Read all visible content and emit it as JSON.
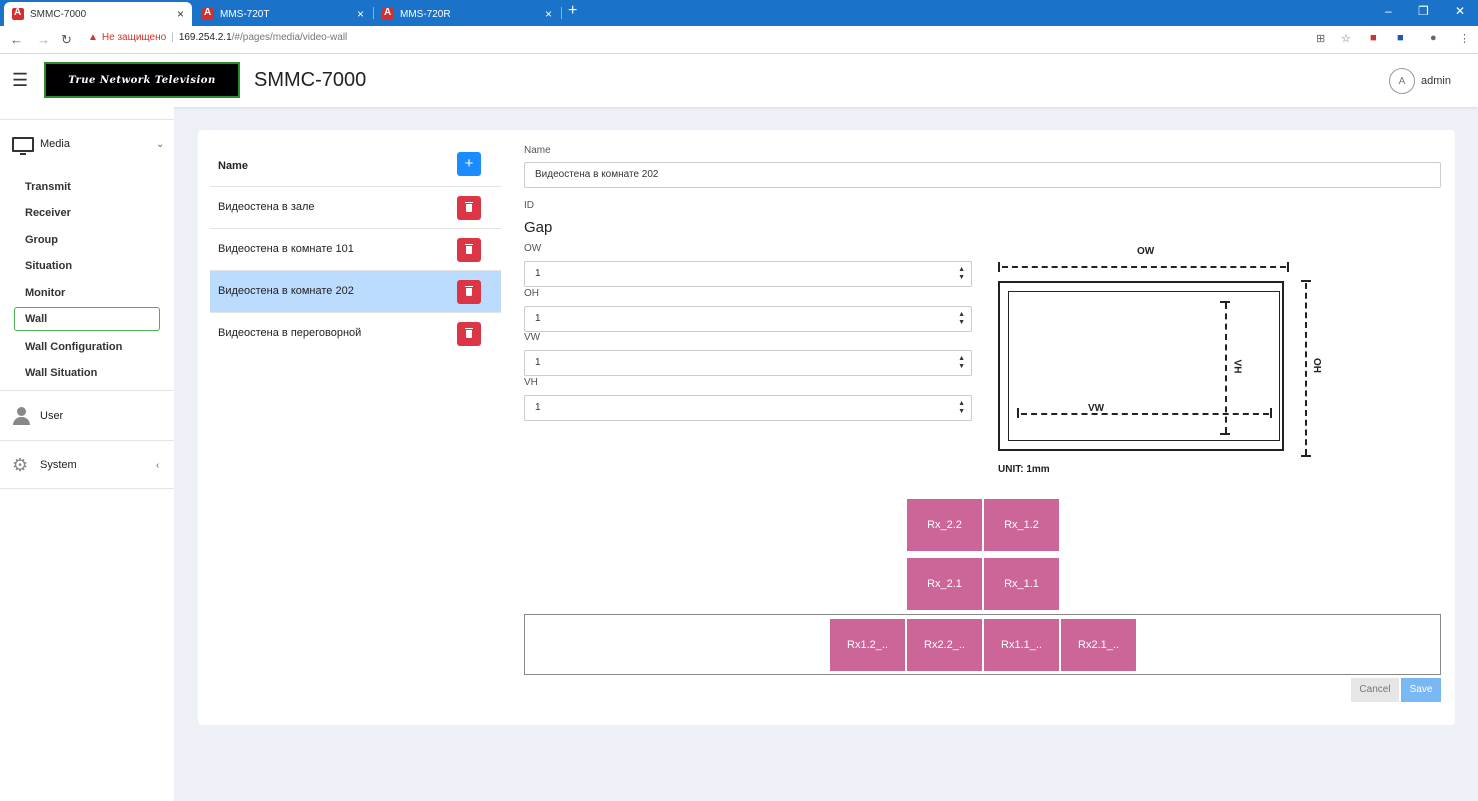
{
  "browser": {
    "tabs": [
      {
        "title": "SMMC-7000"
      },
      {
        "title": "MMS-720T"
      },
      {
        "title": "MMS-720R"
      }
    ],
    "security_warning": "Не защищено",
    "url_host": "169.254.2.1",
    "url_path": "/#/pages/media/video-wall"
  },
  "header": {
    "logo_text": "True Network Television",
    "title": "SMMC-7000",
    "avatar_letter": "A",
    "username": "admin"
  },
  "sidebar": {
    "media_label": "Media",
    "items": [
      {
        "label": "Transmit"
      },
      {
        "label": "Receiver"
      },
      {
        "label": "Group"
      },
      {
        "label": "Situation"
      },
      {
        "label": "Monitor"
      },
      {
        "label": "Wall"
      },
      {
        "label": "Wall Configuration"
      },
      {
        "label": "Wall Situation"
      }
    ],
    "user_label": "User",
    "system_label": "System"
  },
  "list": {
    "header": "Name",
    "rows": [
      {
        "name": "Видеостена в зале"
      },
      {
        "name": "Видеостена в комнате 101"
      },
      {
        "name": "Видеостена в комнате 202"
      },
      {
        "name": "Видеостена в переговорной"
      }
    ],
    "selected_index": 2
  },
  "form": {
    "name_label": "Name",
    "name_value": "Видеостена в комнате 202",
    "id_label": "ID",
    "gap_title": "Gap",
    "ow_label": "OW",
    "ow_value": "1",
    "oh_label": "OH",
    "oh_value": "1",
    "vw_label": "VW",
    "vw_value": "1",
    "vh_label": "VH",
    "vh_value": "1"
  },
  "diagram": {
    "ow": "OW",
    "oh": "OH",
    "vw": "VW",
    "vh": "VH",
    "unit": "UNIT: 1mm"
  },
  "wall": {
    "grid": [
      [
        "Rx_2.2",
        "Rx_1.2"
      ],
      [
        "Rx_2.1",
        "Rx_1.1"
      ]
    ],
    "tray": [
      "Rx1.2_..",
      "Rx2.2_..",
      "Rx1.1_..",
      "Rx2.1_.."
    ],
    "cell_color": "#cc6699"
  },
  "actions": {
    "cancel": "Cancel",
    "save": "Save"
  }
}
